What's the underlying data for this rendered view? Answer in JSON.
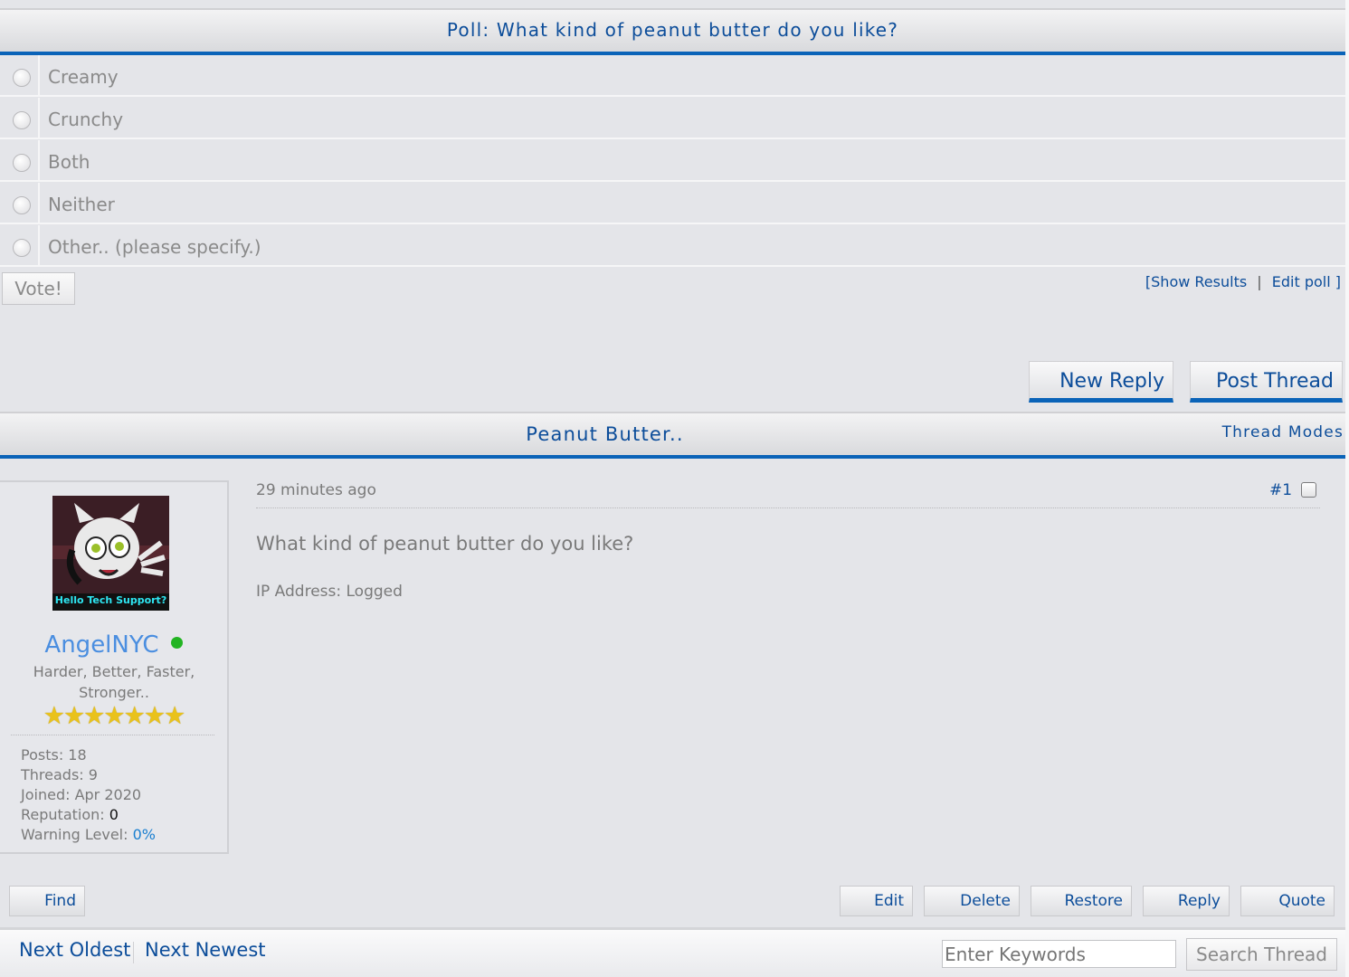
{
  "poll": {
    "title": "Poll: What kind of peanut butter do you like?",
    "options": [
      "Creamy",
      "Crunchy",
      "Both",
      "Neither",
      "Other.. (please specify.)"
    ],
    "vote_label": "Vote!",
    "show_results_label": "Show Results",
    "edit_poll_label": "Edit poll",
    "bracket_open": "[",
    "bracket_close": "]",
    "separator": "|"
  },
  "actions": {
    "new_reply": "New Reply",
    "post_thread": "Post Thread"
  },
  "thread": {
    "title": "Peanut Butter..",
    "modes_label": "Thread Modes"
  },
  "post": {
    "time": "29 minutes ago",
    "number": "#1",
    "body": "What kind of peanut butter do you like?",
    "ip": "IP Address: Logged",
    "author": {
      "avatar_caption": "Hello Tech Support?",
      "username": "AngelNYC",
      "online_color": "#22b422",
      "usertitle": "Harder, Better, Faster, Stronger..",
      "stars": 7,
      "posts_label": "Posts:",
      "posts": "18",
      "threads_label": "Threads:",
      "threads": "9",
      "joined_label": "Joined:",
      "joined": "Apr 2020",
      "rep_label": "Reputation:",
      "rep": "0",
      "warn_label": "Warning Level:",
      "warn": "0%"
    },
    "buttons": {
      "find": "Find",
      "edit": "Edit",
      "delete": "Delete",
      "restore": "Restore",
      "reply": "Reply",
      "quote": "Quote"
    }
  },
  "footer": {
    "next_oldest": "Next Oldest",
    "next_newest": "Next Newest",
    "search_placeholder": "Enter Keywords",
    "search_button": "Search Thread"
  },
  "colors": {
    "accent": "#0a63b8",
    "link": "#0c4d9a",
    "username": "#4a8ee0",
    "star": "#e9c21b"
  }
}
